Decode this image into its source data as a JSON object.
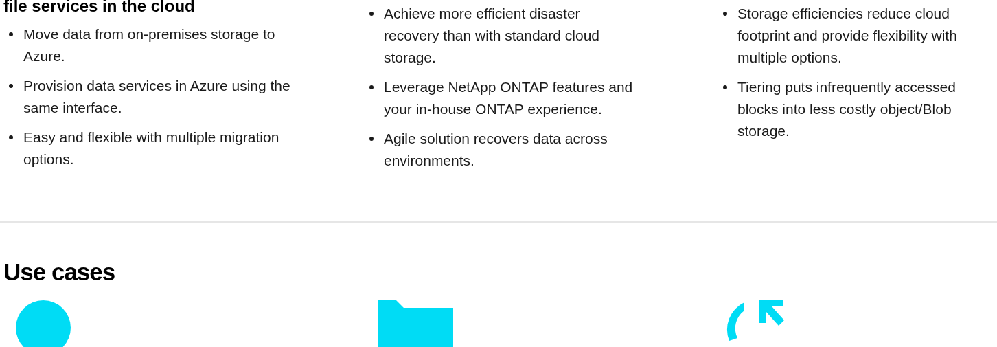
{
  "columns": [
    {
      "heading": "file services in the cloud",
      "bullets": [
        "Move data from on-premises storage to Azure.",
        "Provision data services in Azure using the same interface.",
        "Easy and flexible with multiple migration options."
      ]
    },
    {
      "bullets": [
        "Achieve more efficient disaster recovery than with standard cloud storage.",
        "Leverage NetApp ONTAP features and your in-house ONTAP experience.",
        "Agile solution recovers data across environments."
      ]
    },
    {
      "bullets": [
        "Storage efficiencies reduce cloud footprint and provide flexibility with multiple options.",
        "Tiering puts infrequently accessed blocks into less costly object/Blob storage."
      ]
    }
  ],
  "use_cases": {
    "heading": "Use cases",
    "icons": [
      {
        "kind": "circle"
      },
      {
        "kind": "folder"
      },
      {
        "kind": "refresh"
      }
    ]
  }
}
